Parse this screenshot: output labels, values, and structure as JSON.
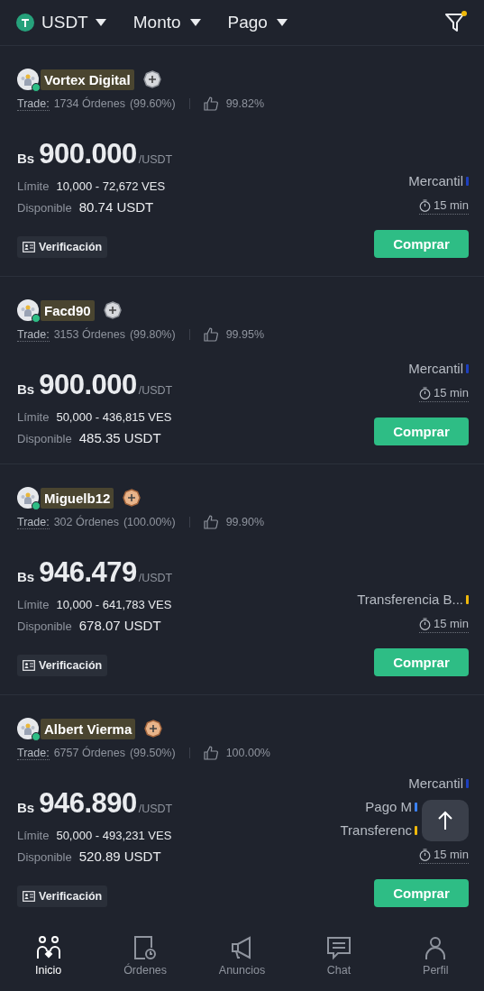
{
  "top_bar": {
    "filters": [
      {
        "label": "USDT",
        "kind": "coin"
      },
      {
        "label": "Monto",
        "kind": "plain"
      },
      {
        "label": "Pago",
        "kind": "plain"
      }
    ],
    "filter_active": true
  },
  "ads": [
    {
      "name": "Vortex Digital",
      "online": true,
      "kind": "silver",
      "trade_label": "Trade:",
      "orders": "1734 Órdenes",
      "completion": "(99.60%)",
      "rating": "99.82%",
      "currency": "Bs",
      "price": "900.000",
      "unit": "/USDT",
      "limit_label": "Límite",
      "limit": "10,000 - 72,672 VES",
      "available_label": "Disponible",
      "available": "80.74 USDT",
      "verified": true,
      "verification": "Verificación",
      "payments": [
        {
          "label": "Mercantil",
          "color": "#1d3fbf",
          "covered": false
        }
      ],
      "time": "15 min",
      "action": "Comprar"
    },
    {
      "name": "Facd90",
      "online": true,
      "kind": "silver",
      "trade_label": "Trade:",
      "orders": "3153 Órdenes",
      "completion": "(99.80%)",
      "rating": "99.95%",
      "currency": "Bs",
      "price": "900.000",
      "unit": "/USDT",
      "limit_label": "Límite",
      "limit": "50,000 - 436,815 VES",
      "available_label": "Disponible",
      "available": "485.35 USDT",
      "verified": false,
      "payments": [
        {
          "label": "Mercantil",
          "color": "#1d3fbf",
          "covered": false
        }
      ],
      "time": "15 min",
      "action": "Comprar"
    },
    {
      "name": "Miguelb12",
      "online": true,
      "kind": "bronze",
      "trade_label": "Trade:",
      "orders": "302 Órdenes",
      "completion": "(100.00%)",
      "rating": "99.90%",
      "currency": "Bs",
      "price": "946.479",
      "unit": "/USDT",
      "limit_label": "Límite",
      "limit": "10,000 - 641,783 VES",
      "available_label": "Disponible",
      "available": "678.07 USDT",
      "verified": true,
      "verification": "Verificación",
      "payments": [
        {
          "label": "Transferencia B...",
          "color": "#f0b90b",
          "covered": false
        }
      ],
      "time": "15 min",
      "action": "Comprar"
    },
    {
      "name": "Albert Vierma",
      "online": true,
      "kind": "bronze",
      "trade_label": "Trade:",
      "orders": "6757 Órdenes",
      "completion": "(99.50%)",
      "rating": "100.00%",
      "currency": "Bs",
      "price": "946.890",
      "unit": "/USDT",
      "limit_label": "Límite",
      "limit": "50,000 - 493,231 VES",
      "available_label": "Disponible",
      "available": "520.89 USDT",
      "verified": true,
      "verification": "Verificación",
      "payments": [
        {
          "label": "Mercantil",
          "color": "#1d3fbf",
          "covered": false
        },
        {
          "label": "Pago M",
          "color": "#3b82f6",
          "covered": true
        },
        {
          "label": "Transferenc",
          "color": "#f0b90b",
          "covered": true
        }
      ],
      "time": "15 min",
      "action": "Comprar"
    }
  ],
  "nav": [
    {
      "label": "Inicio",
      "kind": "home",
      "selected": true
    },
    {
      "label": "Órdenes",
      "kind": "orders",
      "selected": false
    },
    {
      "label": "Anuncios",
      "kind": "ads",
      "selected": false
    },
    {
      "label": "Chat",
      "kind": "chat",
      "selected": false
    },
    {
      "label": "Perfil",
      "kind": "profile",
      "selected": false
    }
  ]
}
